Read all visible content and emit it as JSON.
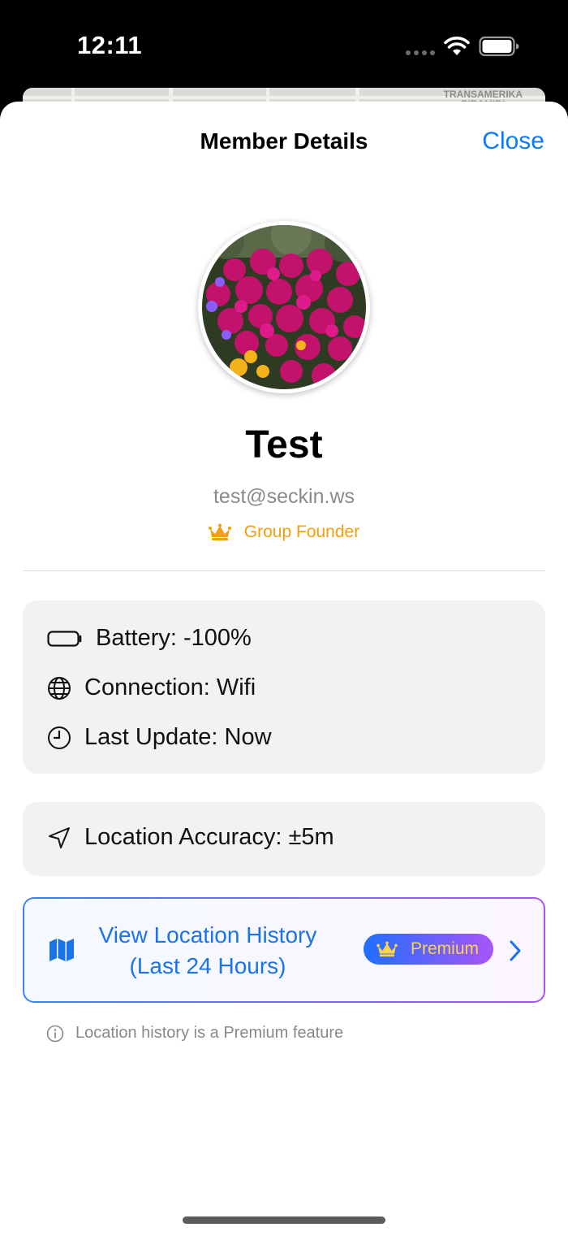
{
  "status_bar": {
    "time": "12:11"
  },
  "map": {
    "label_line1": "TRANSAMERIKA",
    "label_line2": "PIRAMIDI"
  },
  "sheet": {
    "title": "Member Details",
    "close_label": "Close"
  },
  "member": {
    "name": "Test",
    "email": "test@seckin.ws",
    "role": "Group Founder",
    "avatar": "flower-photo"
  },
  "info": {
    "battery": "Battery: -100%",
    "connection": "Connection: Wifi",
    "last_update": "Last Update: Now",
    "accuracy": "Location Accuracy: ±5m"
  },
  "history": {
    "line1": "View Location History",
    "line2": "(Last 24 Hours)",
    "badge": "Premium",
    "note": "Location history is a Premium feature"
  },
  "colors": {
    "accent": "#0a7aff",
    "founder": "#f59e0b",
    "premium_text": "#fcd34d",
    "gradient_start": "#3b82f6",
    "gradient_end": "#a855f7"
  },
  "icons": {
    "battery": "battery-icon",
    "connection": "globe-icon",
    "last_update": "clock-icon",
    "accuracy": "location-arrow-icon",
    "history": "map-icon",
    "role": "crown-icon",
    "navigate": "chevron-right-icon",
    "note": "info-icon"
  }
}
